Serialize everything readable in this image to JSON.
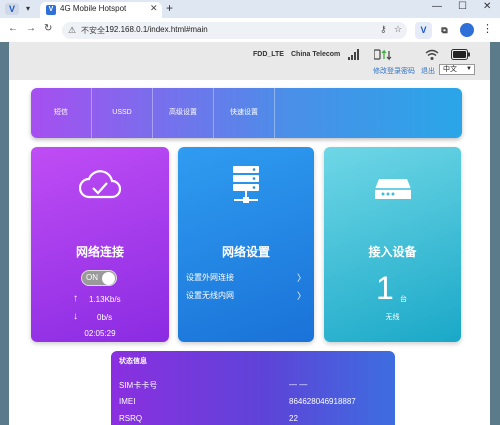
{
  "browser": {
    "tab_title": "4G Mobile Hotspot",
    "insecure_label": "不安全",
    "url": "192.168.0.1/index.html#main"
  },
  "header": {
    "network_type": "FDD_LTE",
    "operator": "China Telecom",
    "change_password": "修改登录密码",
    "logout": "退出",
    "language": "中文"
  },
  "menu": {
    "items": [
      "短信",
      "USSD",
      "高级设置",
      "快速设置"
    ]
  },
  "cards": {
    "network_connection": {
      "title": "网络连接",
      "toggle": "ON",
      "upload_rate": "1.13Kb/s",
      "download_rate": "0b/s",
      "uptime": "02:05:29"
    },
    "network_settings": {
      "title": "网络设置",
      "links": [
        "设置外网连接",
        "设置无线内网"
      ]
    },
    "connected_devices": {
      "title": "接入设备",
      "count": "1",
      "unit": "台",
      "type": "无线"
    }
  },
  "status": {
    "title": "状态信息",
    "rows": [
      {
        "label": "SIM卡卡号",
        "value": "— —"
      },
      {
        "label": "IMEI",
        "value": "864628046918887"
      },
      {
        "label": "RSRQ",
        "value": "22"
      }
    ]
  },
  "colors": {
    "card1": "#a43ff0",
    "card2": "#2585e4",
    "card3": "#3cbfd8",
    "link": "#2f74c8"
  }
}
